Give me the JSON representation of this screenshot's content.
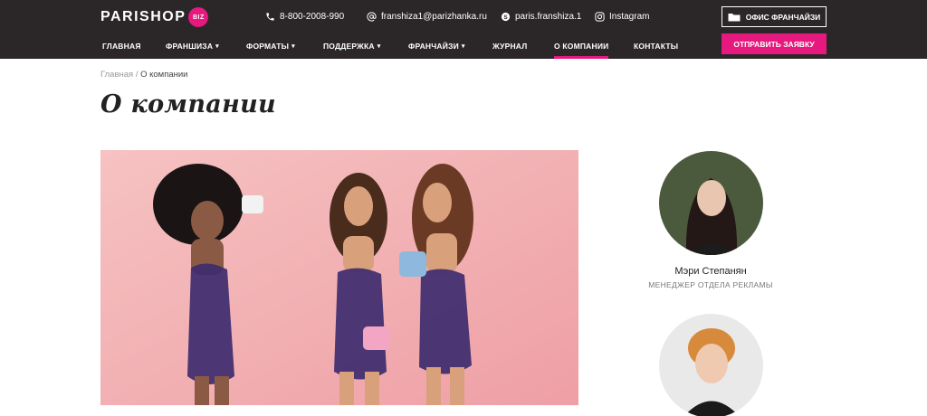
{
  "header": {
    "logo_text": "PARISHOP",
    "logo_badge": "BIZ",
    "phone": "8-800-2008-990",
    "email": "franshiza1@parizhanka.ru",
    "skype": "paris.franshiza.1",
    "instagram": "Instagram",
    "franchise_office_label": "ОФИС ФРАНЧАЙЗИ",
    "submit_label": "ОТПРАВИТЬ ЗАЯВКУ",
    "accent_color": "#e6197e"
  },
  "nav": {
    "items": [
      {
        "label": "ГЛАВНАЯ"
      },
      {
        "label": "ФРАНШИЗА"
      },
      {
        "label": "ФОРМАТЫ"
      },
      {
        "label": "ПОДДЕРЖКА"
      },
      {
        "label": "ФРАНЧАЙЗИ"
      },
      {
        "label": "ЖУРНАЛ"
      },
      {
        "label": "О КОМПАНИИ"
      },
      {
        "label": "КОНТАКТЫ"
      }
    ]
  },
  "breadcrumb": {
    "home": "Главная",
    "separator": "/",
    "current": "О компании"
  },
  "page": {
    "title": "О компании"
  },
  "team": [
    {
      "name": "Мэри Степанян",
      "role": "МЕНЕДЖЕР ОТДЕЛА РЕКЛАМЫ"
    }
  ]
}
